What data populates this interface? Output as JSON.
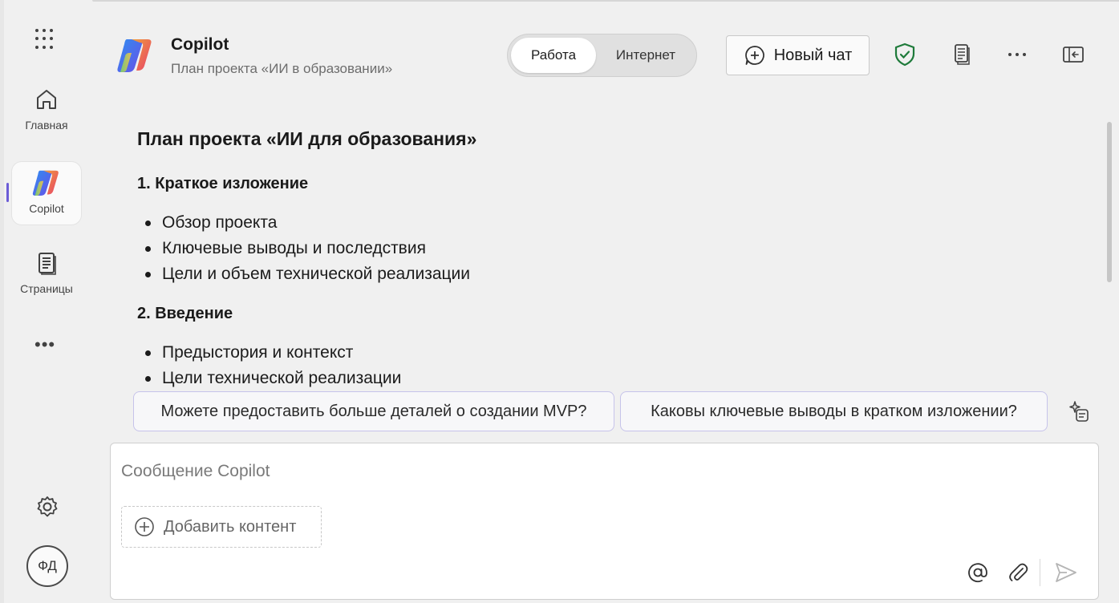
{
  "sidebar": {
    "items": [
      {
        "label": "Главная",
        "icon": "home-icon"
      },
      {
        "label": "Copilot",
        "icon": "copilot-logo-icon",
        "active": true
      },
      {
        "label": "Страницы",
        "icon": "pages-icon"
      }
    ],
    "more_label": "•••",
    "avatar_initials": "ФД"
  },
  "header": {
    "title": "Copilot",
    "subtitle": "План проекта «ИИ в образовании»",
    "toggle": {
      "work": "Работа",
      "web": "Интернет",
      "selected": "Работа"
    },
    "new_chat_label": "Новый чат"
  },
  "document": {
    "title": "План проекта «ИИ для образования»",
    "sections": [
      {
        "heading": "1. Краткое изложение",
        "bullets": [
          "Обзор проекта",
          "Ключевые выводы и последствия",
          "Цели и объем технической реализации"
        ]
      },
      {
        "heading": "2. Введение",
        "bullets": [
          "Предыстория и контекст",
          "Цели технической реализации"
        ]
      }
    ]
  },
  "suggestions": [
    "Можете предоставить больше деталей о создании MVP?",
    "Каковы ключевые выводы в кратком изложении?"
  ],
  "composer": {
    "placeholder": "Сообщение Copilot",
    "add_content_label": "Добавить контент"
  },
  "colors": {
    "accent": "#6b5cd6",
    "shield": "#1e7a3a",
    "suggestion_border": "#c6c3ea"
  }
}
